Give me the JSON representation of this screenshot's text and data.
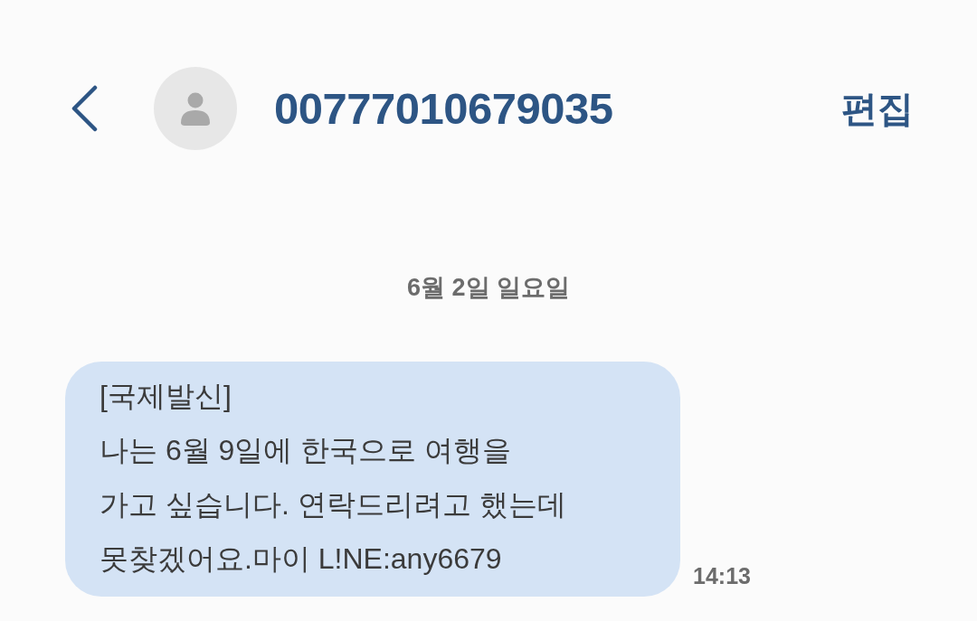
{
  "header": {
    "contact_number": "00777010679035",
    "edit_button": "편집"
  },
  "date_divider": "6월 2일 일요일",
  "messages": [
    {
      "kind": "received",
      "text": "[국제발신]\n나는 6월 9일에 한국으로 여행을\n가고 싶습니다. 연락드리려고 했는데\n못찾겠어요.마이 L!NE:any6679",
      "time": "14:13"
    }
  ]
}
